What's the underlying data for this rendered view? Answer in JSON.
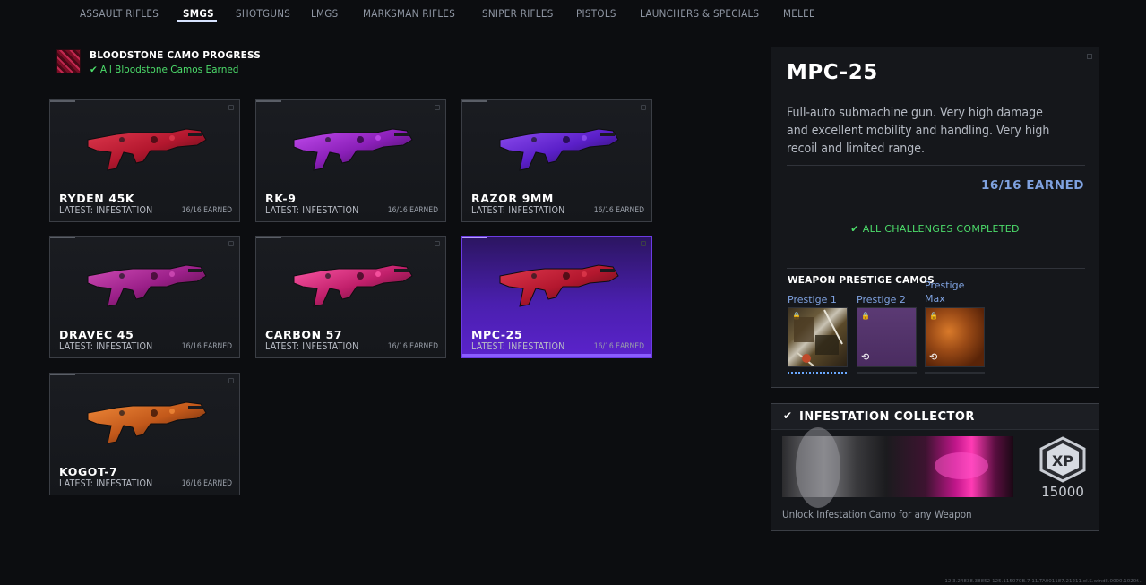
{
  "nav": {
    "tabs": [
      {
        "label": "ASSAULT RIFLES"
      },
      {
        "label": "SMGS"
      },
      {
        "label": "SHOTGUNS"
      },
      {
        "label": "LMGS"
      },
      {
        "label": "MARKSMAN RIFLES"
      },
      {
        "label": "SNIPER RIFLES"
      },
      {
        "label": "PISTOLS"
      },
      {
        "label": "LAUNCHERS & SPECIALS"
      },
      {
        "label": "MELEE"
      }
    ],
    "active": "SMGS"
  },
  "progress": {
    "title": "BLOODSTONE CAMO PROGRESS",
    "status": "All Bloodstone Camos Earned"
  },
  "weapons": [
    {
      "name": "RYDEN 45K",
      "latest": "LATEST: INFESTATION",
      "earned": "16/16 EARNED",
      "camo": "red",
      "selected": false
    },
    {
      "name": "RK-9",
      "latest": "LATEST: INFESTATION",
      "earned": "16/16 EARNED",
      "camo": "purple",
      "selected": false
    },
    {
      "name": "RAZOR 9MM",
      "latest": "LATEST: INFESTATION",
      "earned": "16/16 EARNED",
      "camo": "violet",
      "selected": false
    },
    {
      "name": "DRAVEC 45",
      "latest": "LATEST: INFESTATION",
      "earned": "16/16 EARNED",
      "camo": "magenta",
      "selected": false
    },
    {
      "name": "CARBON 57",
      "latest": "LATEST: INFESTATION",
      "earned": "16/16 EARNED",
      "camo": "pink",
      "selected": false
    },
    {
      "name": "MPC-25",
      "latest": "LATEST: INFESTATION",
      "earned": "16/16 EARNED",
      "camo": "red",
      "selected": true
    },
    {
      "name": "KOGOT-7",
      "latest": "LATEST: INFESTATION",
      "earned": "16/16 EARNED",
      "camo": "orange",
      "selected": false
    }
  ],
  "detail": {
    "title": "MPC-25",
    "description": "Full-auto submachine gun. Very high damage and excellent mobility and handling. Very high recoil and limited range.",
    "earned": "16/16 EARNED",
    "challenges": "ALL CHALLENGES COMPLETED",
    "prestige_header": "WEAPON PRESTIGE CAMOS",
    "prestige": [
      {
        "label": "Prestige 1",
        "locked": true
      },
      {
        "label": "Prestige 2",
        "locked": true
      },
      {
        "label": "Prestige Max",
        "locked": true
      }
    ]
  },
  "collector": {
    "title": "INFESTATION COLLECTOR",
    "xp_label": "XP",
    "xp_value": "15000",
    "description": "Unlock Infestation Camo for any Weapon"
  },
  "colors": {
    "accent_blue": "#7fa2e0",
    "success_green": "#4cdb6a",
    "selected_purple": "#5b23cc"
  },
  "icons": [
    "check-icon",
    "lock-icon",
    "xp-badge-icon",
    "camo-swatch-icon"
  ],
  "footer": {
    "code": "12.3.24838.38852-125.115070B.7-11.TA001187.21211.ol.S.windll.0000.1020f..."
  }
}
